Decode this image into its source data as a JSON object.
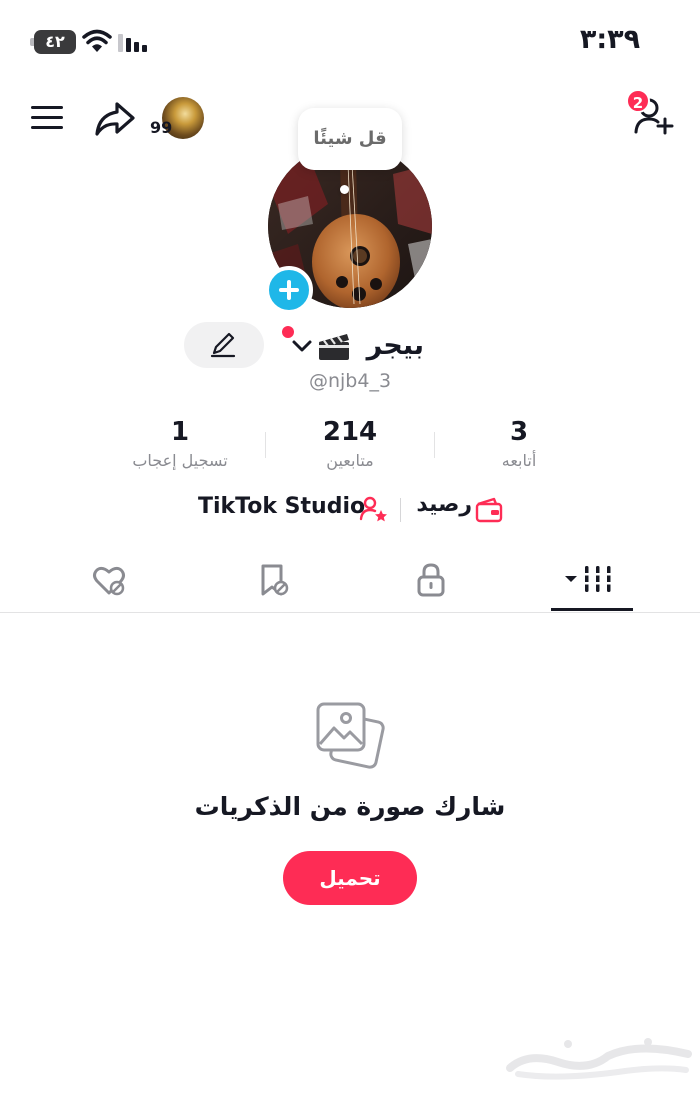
{
  "status_bar": {
    "time": "٣:٣٩",
    "battery": "٤٢"
  },
  "top_bar": {
    "story_count": "99",
    "notification_count": "2"
  },
  "profile": {
    "say_something": "قل شيئًا",
    "display_name": "بيجر",
    "username": "@njb4_3"
  },
  "stats": {
    "likes": {
      "value": "1",
      "label": "تسجيل إعجاب"
    },
    "followers": {
      "value": "214",
      "label": "متابعين"
    },
    "following": {
      "value": "3",
      "label": "أتابعه"
    }
  },
  "tools": {
    "studio_label": "TikTok Studio",
    "balance_label": "رصيد"
  },
  "tabs": [
    {
      "icon": "liked-hidden-icon"
    },
    {
      "icon": "favorites-hidden-icon"
    },
    {
      "icon": "lock-icon"
    },
    {
      "icon": "grid-posts-icon",
      "active": true
    }
  ],
  "empty_state": {
    "title": "شارك صورة من الذكريات",
    "button_label": "تحميل"
  },
  "colors": {
    "accent": "#fe2c55",
    "add_avatar": "#1fb7e8",
    "text_primary": "#161823",
    "text_secondary": "#8a8b91"
  }
}
